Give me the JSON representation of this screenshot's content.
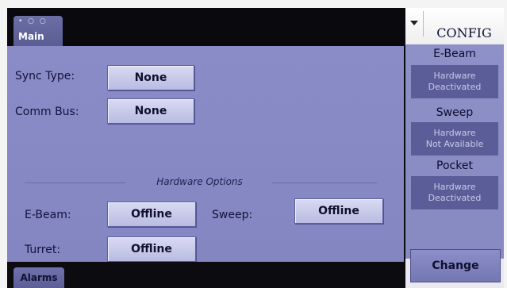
{
  "topbar": {
    "main_tab_label": "Main",
    "main_tab_dots": "• ○ ○"
  },
  "main": {
    "sync_type": {
      "label": "Sync Type:",
      "value": "None"
    },
    "comm_bus": {
      "label": "Comm Bus:",
      "value": "None"
    },
    "hardware_options_title": "Hardware Options",
    "ebeam": {
      "label": "E-Beam:",
      "value": "Offline"
    },
    "sweep": {
      "label": "Sweep:",
      "value": "Offline"
    },
    "turret": {
      "label": "Turret:",
      "value": "Offline"
    }
  },
  "bottombar": {
    "alarms_label": "Alarms"
  },
  "side": {
    "title": "CONFIG",
    "ebeam": {
      "heading": "E-Beam",
      "line1": "Hardware",
      "line2": "Deactivated"
    },
    "sweep": {
      "heading": "Sweep",
      "line1": "Hardware",
      "line2": "Not Available"
    },
    "pocket": {
      "heading": "Pocket",
      "line1": "Hardware",
      "line2": "Deactivated"
    },
    "change_label": "Change"
  },
  "colors": {
    "panel_background": "#8a8cc8",
    "button_face": "#c9cbec",
    "status_box": "#5b5d98",
    "tab_background": "#6c6ea6"
  }
}
